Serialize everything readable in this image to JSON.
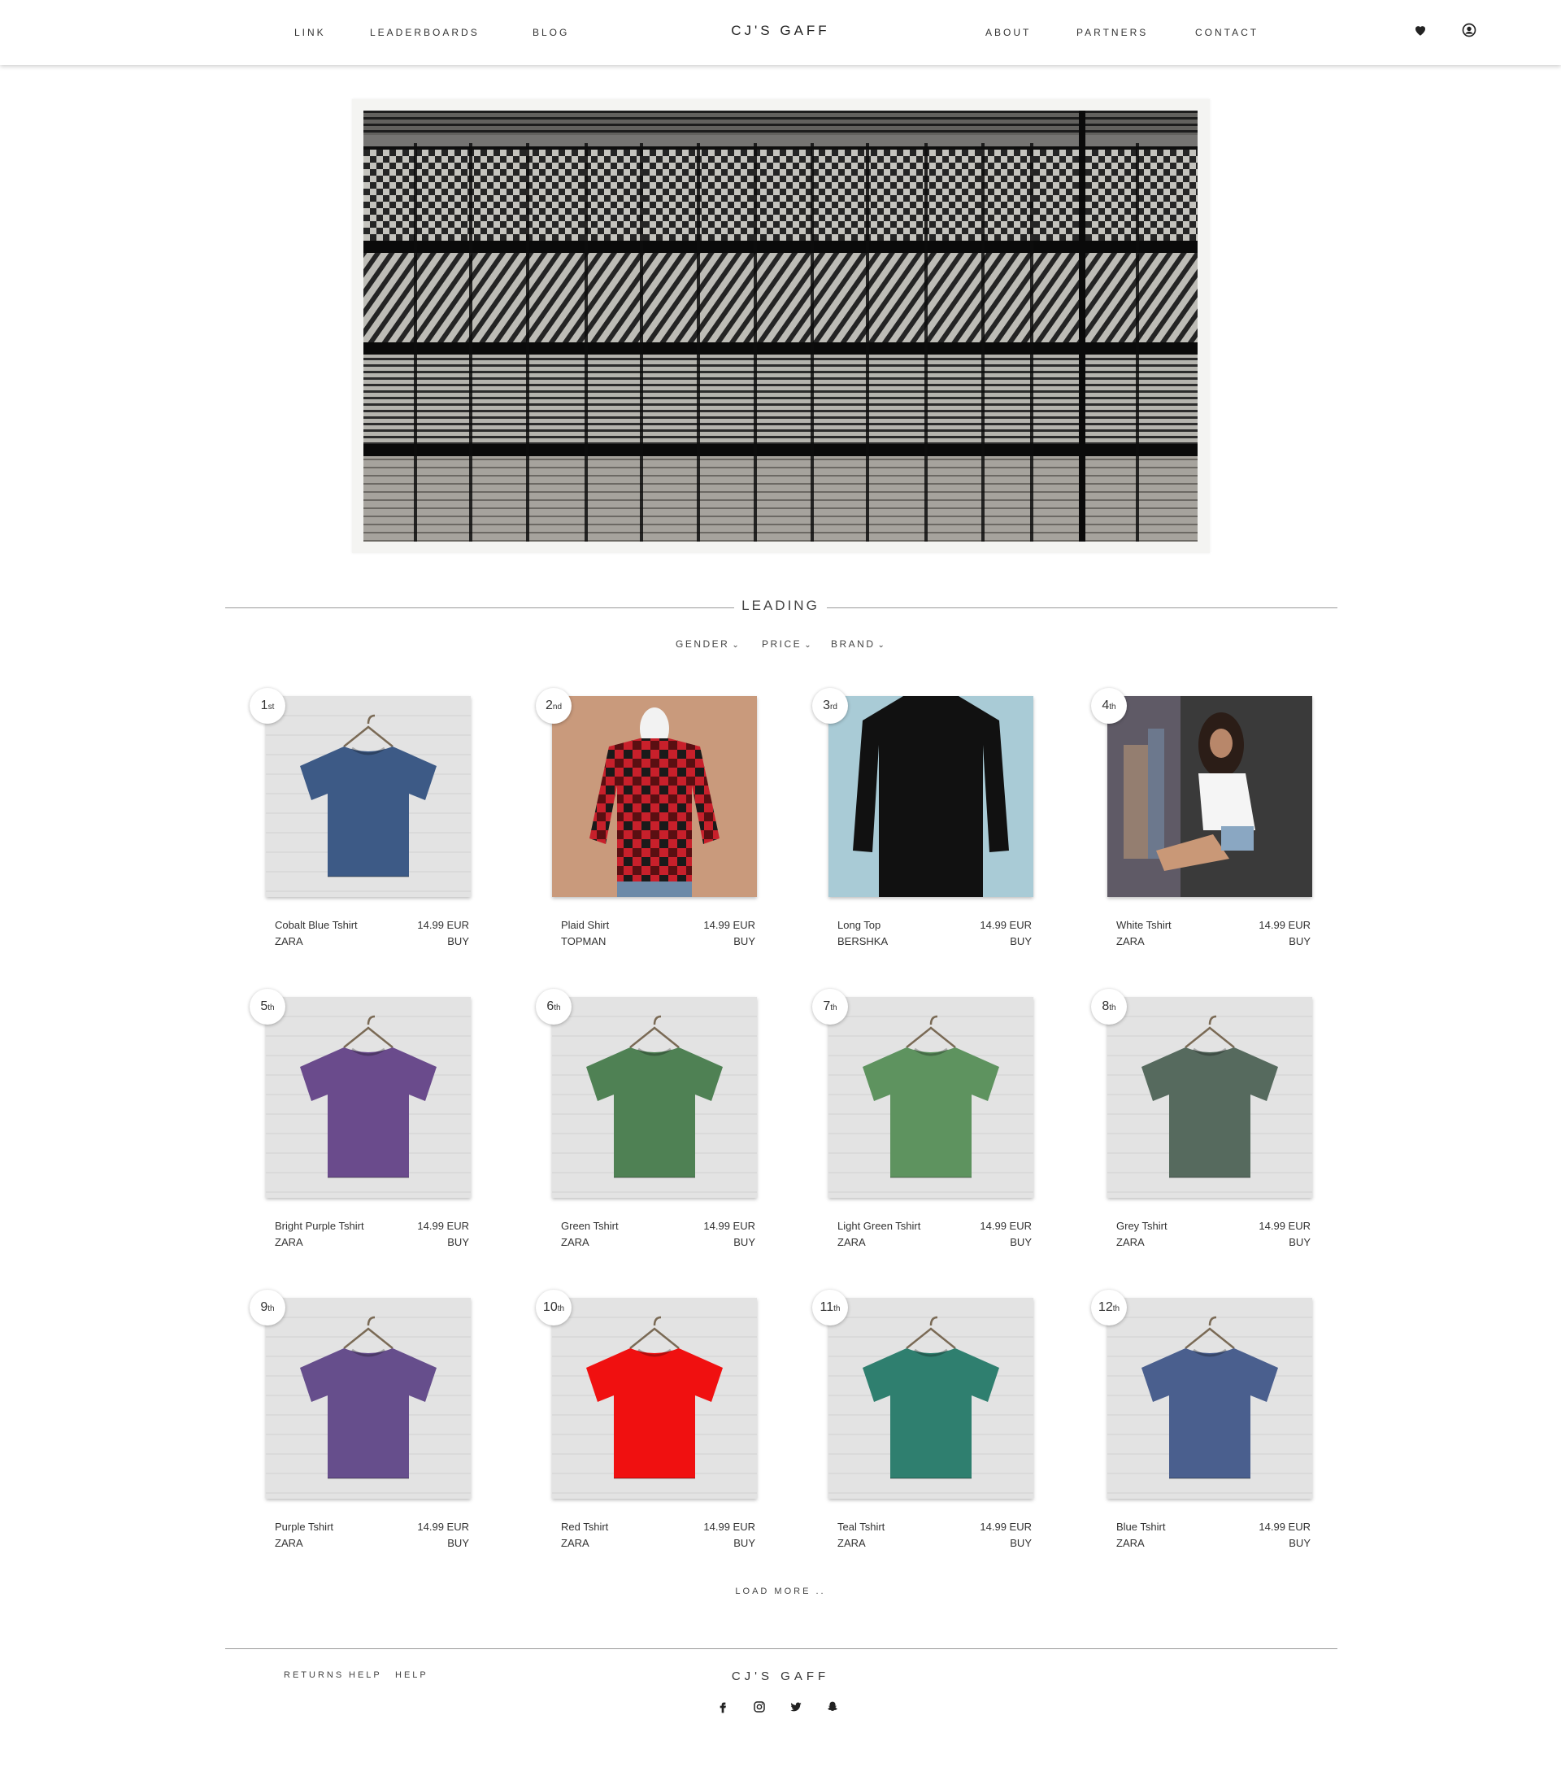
{
  "header": {
    "nav_left": [
      "LINK",
      "LEADERBOARDS",
      "BLOG"
    ],
    "brand": "CJ'S GAFF",
    "nav_right": [
      "ABOUT",
      "PARTNERS",
      "CONTACT"
    ],
    "icons": [
      "heart-icon",
      "user-icon"
    ]
  },
  "section": {
    "title": "LEADING"
  },
  "filters": [
    "GENDER",
    "PRICE",
    "BRAND"
  ],
  "products": [
    {
      "rank": "1",
      "suffix": "st",
      "name": "Cobalt Blue Tshirt",
      "brand": "ZARA",
      "price": "14.99 EUR",
      "action": "BUY",
      "color": "#3d5a86"
    },
    {
      "rank": "2",
      "suffix": "nd",
      "name": "Plaid Shirt",
      "brand": "TOPMAN",
      "price": "14.99 EUR",
      "action": "BUY",
      "color": "#c8202b"
    },
    {
      "rank": "3",
      "suffix": "rd",
      "name": "Long Top",
      "brand": "BERSHKA",
      "price": "14.99 EUR",
      "action": "BUY",
      "color": "#111111"
    },
    {
      "rank": "4",
      "suffix": "th",
      "name": "White Tshirt",
      "brand": "ZARA",
      "price": "14.99 EUR",
      "action": "BUY",
      "color": "#f5f5f5"
    },
    {
      "rank": "5",
      "suffix": "th",
      "name": "Bright Purple Tshirt",
      "brand": "ZARA",
      "price": "14.99 EUR",
      "action": "BUY",
      "color": "#6a4b8c"
    },
    {
      "rank": "6",
      "suffix": "th",
      "name": "Green Tshirt",
      "brand": "ZARA",
      "price": "14.99 EUR",
      "action": "BUY",
      "color": "#4f8154"
    },
    {
      "rank": "7",
      "suffix": "th",
      "name": "Light Green Tshirt",
      "brand": "ZARA",
      "price": "14.99 EUR",
      "action": "BUY",
      "color": "#5e935f"
    },
    {
      "rank": "8",
      "suffix": "th",
      "name": "Grey Tshirt",
      "brand": "ZARA",
      "price": "14.99 EUR",
      "action": "BUY",
      "color": "#566a5e"
    },
    {
      "rank": "9",
      "suffix": "th",
      "name": "Purple Tshirt",
      "brand": "ZARA",
      "price": "14.99 EUR",
      "action": "BUY",
      "color": "#664e8c"
    },
    {
      "rank": "10",
      "suffix": "th",
      "name": "Red Tshirt",
      "brand": "ZARA",
      "price": "14.99 EUR",
      "action": "BUY",
      "color": "#f01010"
    },
    {
      "rank": "11",
      "suffix": "th",
      "name": "Teal Tshirt",
      "brand": "ZARA",
      "price": "14.99 EUR",
      "action": "BUY",
      "color": "#2f7f6f"
    },
    {
      "rank": "12",
      "suffix": "th",
      "name": "Blue Tshirt",
      "brand": "ZARA",
      "price": "14.99 EUR",
      "action": "BUY",
      "color": "#4a5f8e"
    }
  ],
  "load_more": "LOAD MORE ..",
  "footer": {
    "links": [
      "RETURNS",
      "HELP",
      "HELP"
    ],
    "brand": "CJ'S GAFF",
    "social": [
      "facebook-icon",
      "instagram-icon",
      "twitter-icon",
      "snapchat-icon"
    ]
  }
}
